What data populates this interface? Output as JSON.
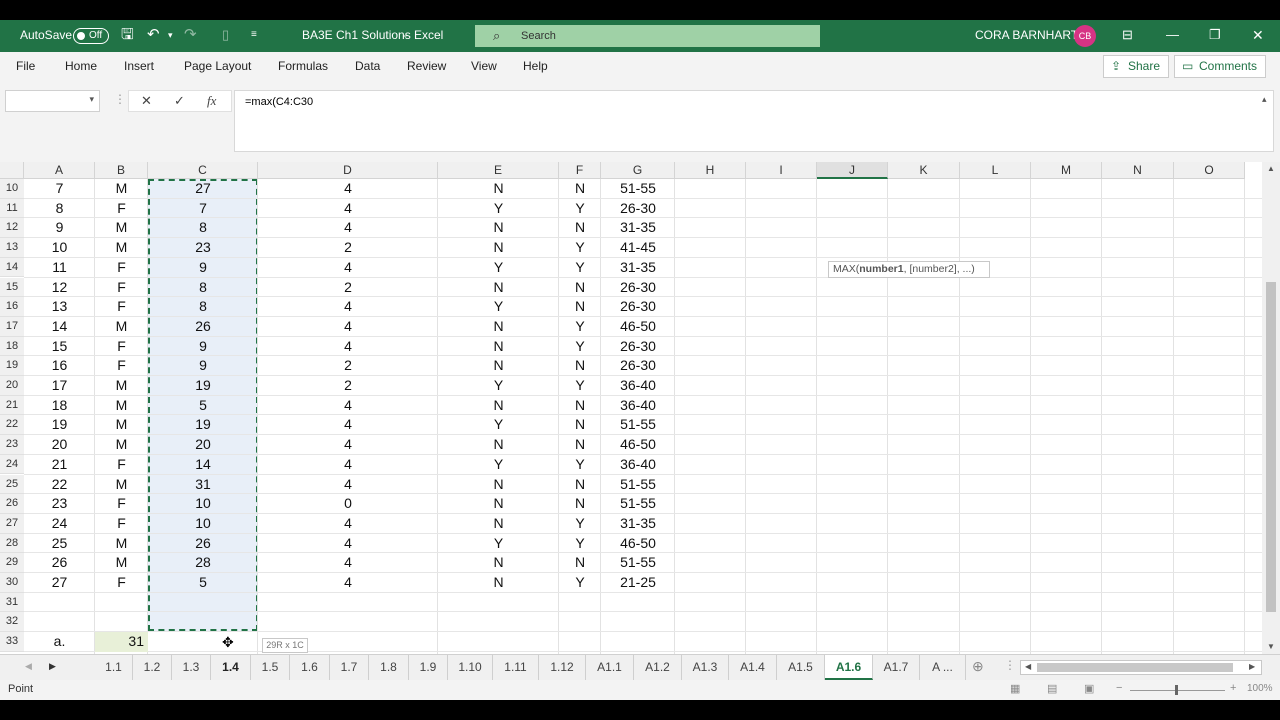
{
  "titlebar": {
    "autosave_label": "AutoSave",
    "autosave_state": "Off",
    "doc_title": "BA3E Ch1 Solutions",
    "separator": "-",
    "app_name": "Excel",
    "search_placeholder": "Search",
    "user_name": "CORA BARNHART",
    "user_initials": "CB"
  },
  "menu": {
    "items": [
      "File",
      "Home",
      "Insert",
      "Page Layout",
      "Formulas",
      "Data",
      "Review",
      "View",
      "Help"
    ],
    "share_label": "Share",
    "comments_label": "Comments"
  },
  "formula_bar": {
    "name_box": "",
    "cancel_glyph": "✕",
    "enter_glyph": "✓",
    "fx_label": "fx",
    "formula": "=max(C4:C30"
  },
  "columns": [
    "A",
    "B",
    "C",
    "D",
    "E",
    "F",
    "G",
    "H",
    "I",
    "J",
    "K",
    "L",
    "M",
    "N",
    "O"
  ],
  "rows": [
    {
      "n": "10",
      "a": "7",
      "b": "M",
      "c": "27",
      "d": "4",
      "e": "N",
      "f": "N",
      "g": "51-55"
    },
    {
      "n": "11",
      "a": "8",
      "b": "F",
      "c": "7",
      "d": "4",
      "e": "Y",
      "f": "Y",
      "g": "26-30"
    },
    {
      "n": "12",
      "a": "9",
      "b": "M",
      "c": "8",
      "d": "4",
      "e": "N",
      "f": "N",
      "g": "31-35"
    },
    {
      "n": "13",
      "a": "10",
      "b": "M",
      "c": "23",
      "d": "2",
      "e": "N",
      "f": "Y",
      "g": "41-45"
    },
    {
      "n": "14",
      "a": "11",
      "b": "F",
      "c": "9",
      "d": "4",
      "e": "Y",
      "f": "Y",
      "g": "31-35"
    },
    {
      "n": "15",
      "a": "12",
      "b": "F",
      "c": "8",
      "d": "2",
      "e": "N",
      "f": "N",
      "g": "26-30"
    },
    {
      "n": "16",
      "a": "13",
      "b": "F",
      "c": "8",
      "d": "4",
      "e": "Y",
      "f": "N",
      "g": "26-30"
    },
    {
      "n": "17",
      "a": "14",
      "b": "M",
      "c": "26",
      "d": "4",
      "e": "N",
      "f": "Y",
      "g": "46-50"
    },
    {
      "n": "18",
      "a": "15",
      "b": "F",
      "c": "9",
      "d": "4",
      "e": "N",
      "f": "Y",
      "g": "26-30"
    },
    {
      "n": "19",
      "a": "16",
      "b": "F",
      "c": "9",
      "d": "2",
      "e": "N",
      "f": "N",
      "g": "26-30"
    },
    {
      "n": "20",
      "a": "17",
      "b": "M",
      "c": "19",
      "d": "2",
      "e": "Y",
      "f": "Y",
      "g": "36-40"
    },
    {
      "n": "21",
      "a": "18",
      "b": "M",
      "c": "5",
      "d": "4",
      "e": "N",
      "f": "N",
      "g": "36-40"
    },
    {
      "n": "22",
      "a": "19",
      "b": "M",
      "c": "19",
      "d": "4",
      "e": "Y",
      "f": "N",
      "g": "51-55"
    },
    {
      "n": "23",
      "a": "20",
      "b": "M",
      "c": "20",
      "d": "4",
      "e": "N",
      "f": "N",
      "g": "46-50"
    },
    {
      "n": "24",
      "a": "21",
      "b": "F",
      "c": "14",
      "d": "4",
      "e": "Y",
      "f": "Y",
      "g": "36-40"
    },
    {
      "n": "25",
      "a": "22",
      "b": "M",
      "c": "31",
      "d": "4",
      "e": "N",
      "f": "N",
      "g": "51-55"
    },
    {
      "n": "26",
      "a": "23",
      "b": "F",
      "c": "10",
      "d": "0",
      "e": "N",
      "f": "N",
      "g": "51-55"
    },
    {
      "n": "27",
      "a": "24",
      "b": "F",
      "c": "10",
      "d": "4",
      "e": "N",
      "f": "Y",
      "g": "31-35"
    },
    {
      "n": "28",
      "a": "25",
      "b": "M",
      "c": "26",
      "d": "4",
      "e": "Y",
      "f": "Y",
      "g": "46-50"
    },
    {
      "n": "29",
      "a": "26",
      "b": "M",
      "c": "28",
      "d": "4",
      "e": "N",
      "f": "N",
      "g": "51-55"
    },
    {
      "n": "30",
      "a": "27",
      "b": "F",
      "c": "5",
      "d": "4",
      "e": "N",
      "f": "Y",
      "g": "21-25"
    },
    {
      "n": "31",
      "a": "",
      "b": "",
      "c": "",
      "d": "",
      "e": "",
      "f": "",
      "g": ""
    },
    {
      "n": "32",
      "a": "",
      "b": "",
      "c": "",
      "d": "",
      "e": "",
      "f": "",
      "g": ""
    },
    {
      "n": "33",
      "a": "a.",
      "b": "31",
      "c": "",
      "d": "",
      "e": "",
      "f": "",
      "g": ""
    }
  ],
  "tooltip": {
    "fn": "MAX(",
    "arg1": "number1",
    ",": ", ",
    "rest": "[number2], ...)"
  },
  "size_tip": "29R x 1C",
  "tabs": [
    "1.1",
    "1.2",
    "1.3",
    "1.4",
    "1.5",
    "1.6",
    "1.7",
    "1.8",
    "1.9",
    "1.10",
    "1.11",
    "1.12",
    "A1.1",
    "A1.2",
    "A1.3",
    "A1.4",
    "A1.5",
    "A1.6",
    "A1.7",
    "A ..."
  ],
  "active_tab": "A1.6",
  "status": {
    "mode": "Point",
    "zoom": "100%"
  },
  "colors": {
    "excel_green": "#217346",
    "selection_fill": "#e8eff8",
    "avatar": "#d63384"
  }
}
